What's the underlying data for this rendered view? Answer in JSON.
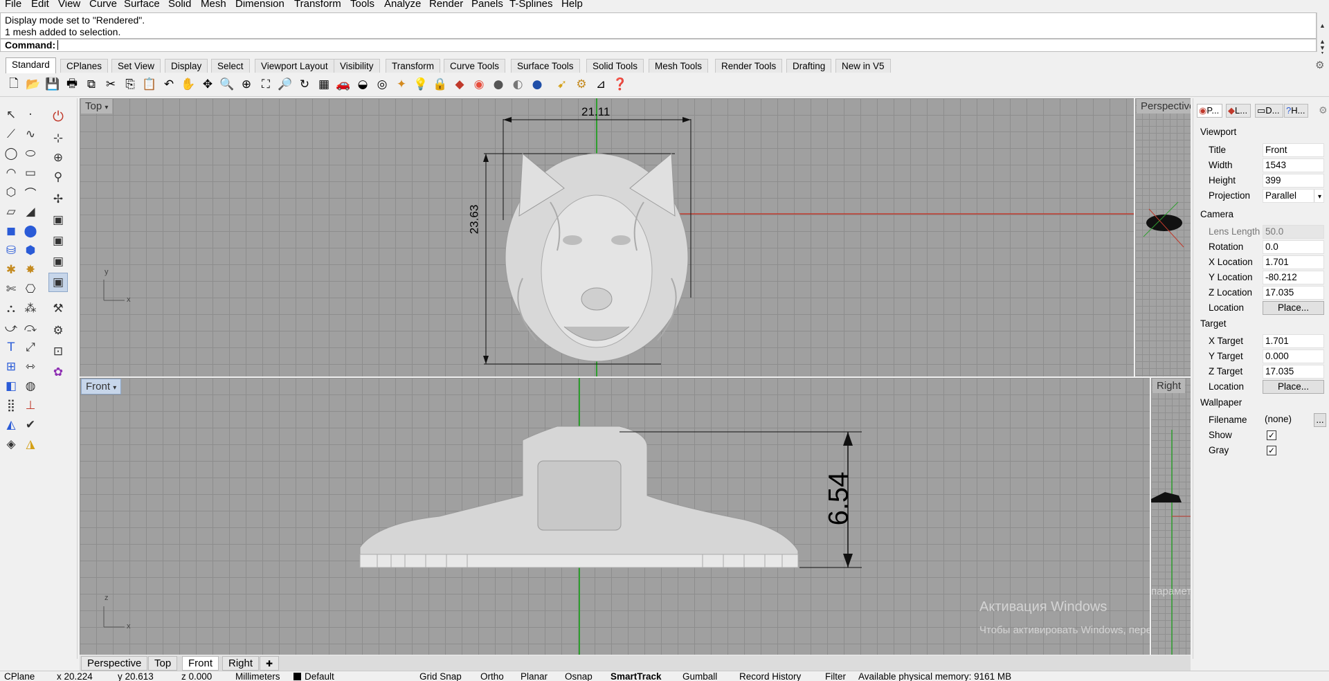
{
  "menu": [
    "File",
    "Edit",
    "View",
    "Curve",
    "Surface",
    "Solid",
    "Mesh",
    "Dimension",
    "Transform",
    "Tools",
    "Analyze",
    "Render",
    "Panels",
    "T-Splines",
    "Help"
  ],
  "command": {
    "history": [
      "Display mode set to \"Rendered\".",
      "1 mesh added to selection."
    ],
    "prompt": "Command:"
  },
  "toolbar_tabs": [
    "Standard",
    "CPlanes",
    "Set View",
    "Display",
    "Select",
    "Viewport Layout",
    "Visibility",
    "Transform",
    "Curve Tools",
    "Surface Tools",
    "Solid Tools",
    "Mesh Tools",
    "Render Tools",
    "Drafting",
    "New in V5"
  ],
  "toolbar_active_tab": "Standard",
  "viewports": {
    "top": {
      "title": "Top",
      "dim_width": "21.11",
      "dim_height": "23.63",
      "axis_y": "y",
      "axis_x": "x"
    },
    "front": {
      "title": "Front",
      "dim_height": "6.54",
      "axis_y": "z",
      "axis_x": "x"
    },
    "perspective": {
      "title": "Perspective"
    },
    "right": {
      "title": "Right"
    }
  },
  "viewport_tabs": [
    "Perspective",
    "Top",
    "Front",
    "Right"
  ],
  "viewport_active_tab": "Front",
  "properties": {
    "tabs": [
      "P...",
      "L...",
      "D...",
      "H..."
    ],
    "viewport_header": "Viewport",
    "title_label": "Title",
    "title_value": "Front",
    "width_label": "Width",
    "width_value": "1543",
    "height_label": "Height",
    "height_value": "399",
    "projection_label": "Projection",
    "projection_value": "Parallel",
    "camera_header": "Camera",
    "lens_label": "Lens Length",
    "lens_value": "50.0",
    "rotation_label": "Rotation",
    "rotation_value": "0.0",
    "xloc_label": "X Location",
    "xloc_value": "1.701",
    "yloc_label": "Y Location",
    "yloc_value": "-80.212",
    "zloc_label": "Z Location",
    "zloc_value": "17.035",
    "location_label": "Location",
    "place_label": "Place...",
    "target_header": "Target",
    "xtarget_label": "X Target",
    "xtarget_value": "1.701",
    "ytarget_label": "Y Target",
    "ytarget_value": "0.000",
    "ztarget_label": "Z Target",
    "ztarget_value": "17.035",
    "tlocation_label": "Location",
    "tplace_label": "Place...",
    "wallpaper_header": "Wallpaper",
    "filename_label": "Filename",
    "filename_value": "(none)",
    "browse_label": "...",
    "show_label": "Show",
    "gray_label": "Gray"
  },
  "statusbar": {
    "cplane": "CPlane",
    "x": "x 20.224",
    "y": "y 20.613",
    "z": "z 0.000",
    "units": "Millimeters",
    "layer": "Default",
    "grid_snap": "Grid Snap",
    "ortho": "Ortho",
    "planar": "Planar",
    "osnap": "Osnap",
    "smarttrack": "SmartTrack",
    "gumball": "Gumball",
    "record_history": "Record History",
    "filter": "Filter",
    "memory": "Available physical memory: 9161 MB"
  },
  "watermark": {
    "line1": "Активация Windows",
    "line2": "Чтобы активировать Windows, перейдите в раздел",
    "line3": "параметры."
  },
  "colors": {
    "x_axis": "#c0392b",
    "y_axis": "#2e9e2e",
    "viewport_bg": "#a0a0a0",
    "active_title_bg": "#c7d6ea"
  }
}
